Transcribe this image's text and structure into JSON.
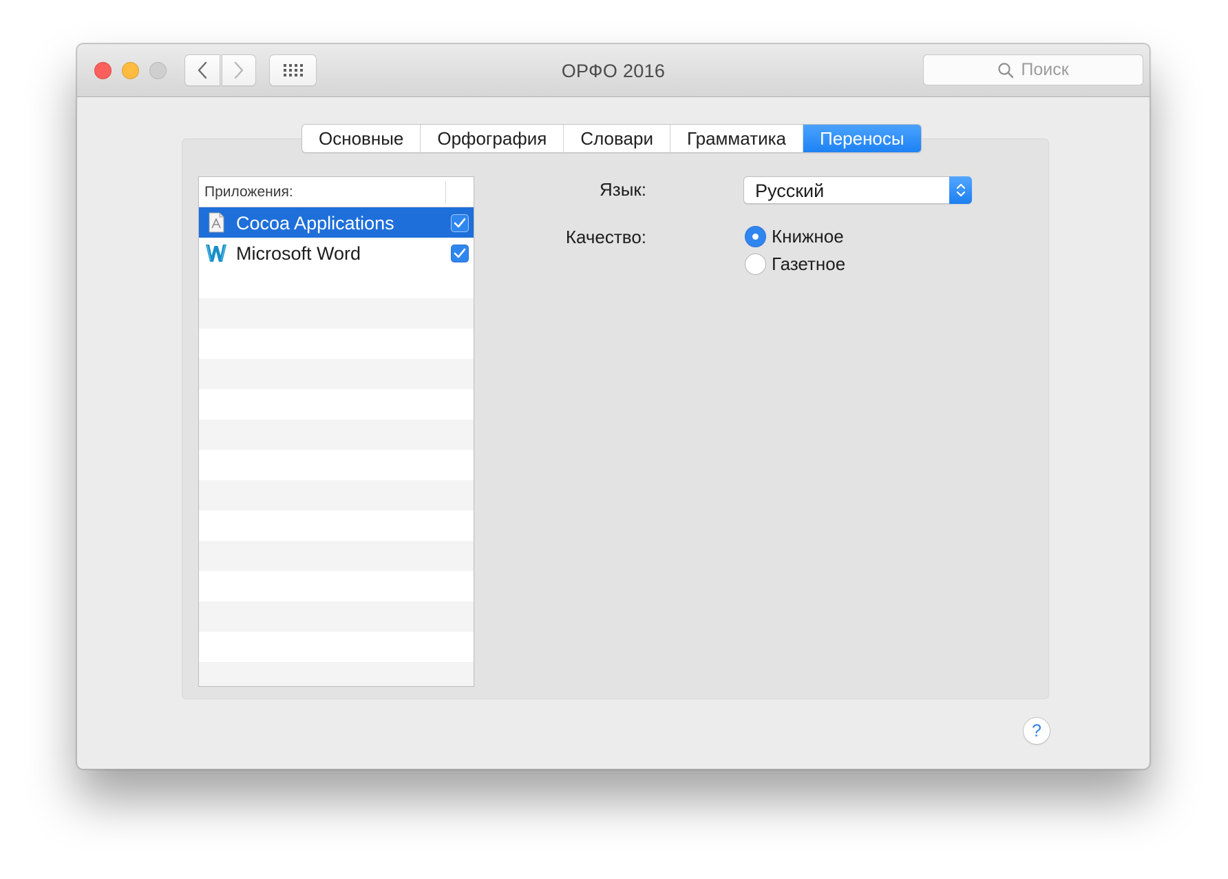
{
  "window": {
    "title": "ОРФО 2016"
  },
  "toolbar": {
    "back_icon": "chevron-left-icon",
    "forward_icon": "chevron-right-icon",
    "grid_icon": "grid-icon"
  },
  "search": {
    "placeholder": "Поиск",
    "icon": "search-icon"
  },
  "tabs": [
    {
      "label": "Основные",
      "active": false
    },
    {
      "label": "Орфография",
      "active": false
    },
    {
      "label": "Словари",
      "active": false
    },
    {
      "label": "Грамматика",
      "active": false
    },
    {
      "label": "Переносы",
      "active": true
    }
  ],
  "apps": {
    "header": "Приложения:",
    "items": [
      {
        "name": "Cocoa Applications",
        "icon": "cocoa-app-icon",
        "checked": true,
        "selected": true
      },
      {
        "name": "Microsoft Word",
        "icon": "word-icon",
        "checked": true,
        "selected": false
      }
    ]
  },
  "language": {
    "label": "Язык:",
    "value": "Русский"
  },
  "quality": {
    "label": "Качество:",
    "options": [
      {
        "label": "Книжное",
        "checked": true
      },
      {
        "label": "Газетное",
        "checked": false
      }
    ]
  },
  "help": {
    "label": "?"
  },
  "colors": {
    "accent": "#1e82f4",
    "selection": "#1e6fda",
    "close": "#fc605c",
    "minimize": "#fdbc40"
  }
}
